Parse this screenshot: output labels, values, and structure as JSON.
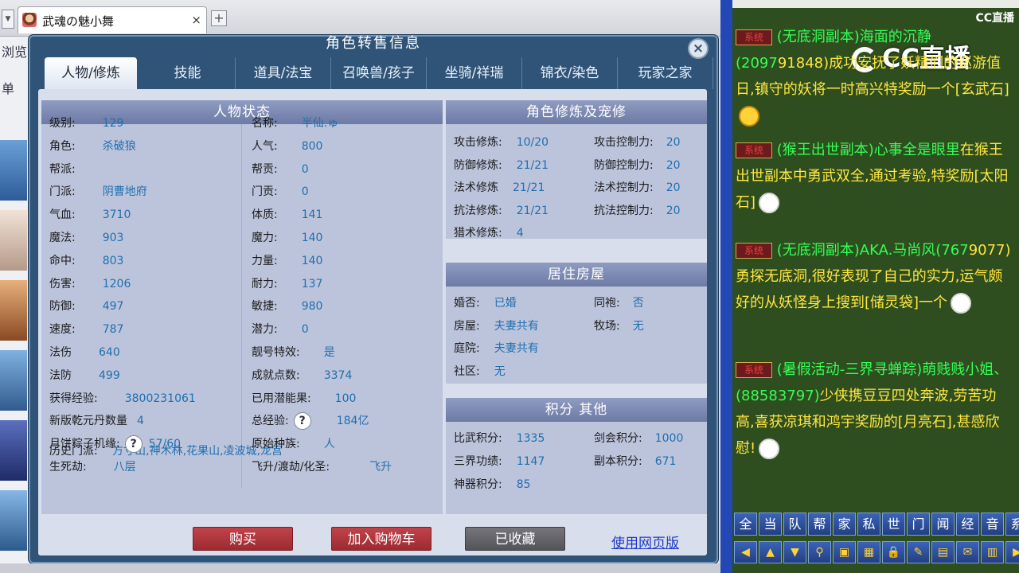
{
  "browser": {
    "tab_title": "武魂の魅小舞",
    "tab_close": "×",
    "new_tab": "+",
    "tab_menu": "▼",
    "side_labels": [
      "浏览",
      "单"
    ]
  },
  "panel": {
    "title": "角色转售信息",
    "close": "×",
    "tabs": [
      "人物/修炼",
      "技能",
      "道具/法宝",
      "召唤兽/孩子",
      "坐骑/祥瑞",
      "锦衣/染色",
      "玩家之家"
    ],
    "status": {
      "header": "人物状态",
      "left": [
        {
          "k": "级别:",
          "v": "129"
        },
        {
          "k": "角色:",
          "v": "杀破狼"
        },
        {
          "k": "帮派:",
          "v": ""
        },
        {
          "k": "门派:",
          "v": "阴曹地府"
        },
        {
          "k": "气血:",
          "v": "3710"
        },
        {
          "k": "魔法:",
          "v": "903"
        },
        {
          "k": "命中:",
          "v": "803"
        },
        {
          "k": "伤害:",
          "v": "1206"
        },
        {
          "k": "防御:",
          "v": "497"
        },
        {
          "k": "速度:",
          "v": "787"
        },
        {
          "k": "法伤",
          "v": "640"
        },
        {
          "k": "法防",
          "v": "499"
        },
        {
          "k": "获得经验:",
          "v": "3800231061"
        },
        {
          "k": "新版乾元丹数量",
          "v": "4"
        },
        {
          "k": "月饼粽子机缘:",
          "v": "57/60"
        },
        {
          "k": "生死劫:",
          "v": "八层"
        }
      ],
      "right": [
        {
          "k": "名称:",
          "v": "半仙.ゅ"
        },
        {
          "k": "人气:",
          "v": "800"
        },
        {
          "k": "帮贡:",
          "v": "0"
        },
        {
          "k": "门贡:",
          "v": "0"
        },
        {
          "k": "体质:",
          "v": "141"
        },
        {
          "k": "魔力:",
          "v": "140"
        },
        {
          "k": "力量:",
          "v": "140"
        },
        {
          "k": "耐力:",
          "v": "137"
        },
        {
          "k": "敏捷:",
          "v": "980"
        },
        {
          "k": "潜力:",
          "v": "0"
        },
        {
          "k": "靓号特效:",
          "v": "是"
        },
        {
          "k": "成就点数:",
          "v": "3374"
        },
        {
          "k": "已用潜能果:",
          "v": "100"
        },
        {
          "k": "总经验:",
          "v": "184亿"
        },
        {
          "k": "原始种族:",
          "v": "人"
        },
        {
          "k": "飞升/渡劫/化圣:",
          "v": "飞升"
        }
      ],
      "history_k": "历史门派:",
      "history_v": "方寸山,神木林,花果山,凌波城,龙宫",
      "help": "?"
    },
    "cultivation": {
      "header": "角色修炼及宠修",
      "rows": [
        {
          "k1": "攻击修炼:",
          "v1": "10/20",
          "k2": "攻击控制力:",
          "v2": "20"
        },
        {
          "k1": "防御修炼:",
          "v1": "21/21",
          "k2": "防御控制力:",
          "v2": "20"
        },
        {
          "k1": "法术修炼",
          "v1": "21/21",
          "k2": "法术控制力:",
          "v2": "20"
        },
        {
          "k1": "抗法修炼:",
          "v1": "21/21",
          "k2": "抗法控制力:",
          "v2": "20"
        },
        {
          "k1": "猎术修炼:",
          "v1": "4",
          "k2": "",
          "v2": ""
        }
      ]
    },
    "house": {
      "header": "居住房屋",
      "rows": [
        {
          "k1": "婚否:",
          "v1": "已婚",
          "k2": "同袍:",
          "v2": "否"
        },
        {
          "k1": "房屋:",
          "v1": "夫妻共有",
          "k2": "牧场:",
          "v2": "无"
        },
        {
          "k1": "庭院:",
          "v1": "夫妻共有",
          "k2": "",
          "v2": ""
        },
        {
          "k1": "社区:",
          "v1": "无",
          "k2": "",
          "v2": ""
        }
      ]
    },
    "points": {
      "header": "积分 其他",
      "rows": [
        {
          "k1": "比武积分:",
          "v1": "1335",
          "k2": "剑会积分:",
          "v2": "1000"
        },
        {
          "k1": "三界功绩:",
          "v1": "1147",
          "k2": "副本积分:",
          "v2": "671"
        },
        {
          "k1": "神器积分:",
          "v1": "85",
          "k2": "",
          "v2": ""
        }
      ]
    },
    "buttons": {
      "buy": "购买",
      "cart": "加入购物车",
      "fav": "已收藏",
      "web": "使用网页版"
    }
  },
  "chat": {
    "logo_small": "CC直播",
    "logo_big": "CC直播",
    "sys": "系统",
    "messages": [
      {
        "g": "(无底洞副本)海面的沉静(2097",
        "y": "91848)成功安抚了妖精们的巡游值日,镇守的妖将一时高兴特奖励一个[玄武石]"
      },
      {
        "g": "(猴王出世副本)心事全是眼里",
        "y": "在猴王出世副本中勇武双全,通过考验,特奖励[太阳石]"
      },
      {
        "g": "(无底洞副本)AKA.马尚风(767",
        "y": "9077)勇探无底洞,很好表现了自己的实力,运气颇好的从妖怪身上搜到[储灵袋]一个"
      },
      {
        "g": "(暑假活动-三界寻蝉踪)萌贱贱小姐、(88583797)",
        "y": "少侠携豆豆四处奔波,劳苦功高,喜获凉琪和鸿宇奖励的[月亮石],甚感欣慰!"
      }
    ],
    "channels": [
      "全",
      "当",
      "队",
      "帮",
      "家",
      "私",
      "世",
      "门",
      "闻",
      "经",
      "音",
      "系"
    ],
    "tools": [
      "◀",
      "▲",
      "▼",
      "⚲",
      "▣",
      "▦",
      "🔒",
      "✎",
      "▤",
      "✉",
      "▥",
      "▶"
    ]
  }
}
